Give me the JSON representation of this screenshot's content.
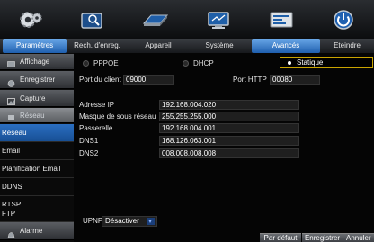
{
  "tabs": [
    {
      "label": "Paramètres"
    },
    {
      "label": "Rech. d'enreg."
    },
    {
      "label": "Appareil"
    },
    {
      "label": "Système"
    },
    {
      "label": "Avancés"
    },
    {
      "label": "Eteindre"
    }
  ],
  "icons": [
    "settings-gear-icon",
    "search-record-icon",
    "device-icon",
    "system-icon",
    "advanced-icon",
    "power-icon"
  ],
  "sidebar": {
    "items": [
      {
        "label": "Affichage",
        "icon": "display-icon"
      },
      {
        "label": "Enregistrer",
        "icon": "record-icon"
      },
      {
        "label": "Capture",
        "icon": "capture-icon"
      },
      {
        "label": "Réseau",
        "icon": "network-icon"
      }
    ],
    "sub": [
      {
        "label": "Réseau"
      },
      {
        "label": "Email"
      },
      {
        "label": "Planification Email"
      },
      {
        "label": "DDNS"
      },
      {
        "label": "RTSP"
      },
      {
        "label": "FTP"
      }
    ],
    "alarm": {
      "label": "Alarme",
      "icon": "alarm-icon"
    }
  },
  "network": {
    "modes": [
      "PPPOE",
      "DHCP",
      "Statique"
    ],
    "selected_mode": "Statique",
    "client_port_label": "Port du client",
    "client_port": "09000",
    "http_port_label": "Port HTTP",
    "http_port": "00080",
    "ip_label": "Adresse IP",
    "ip": "192.168.004.020",
    "mask_label": "Masque de sous réseau",
    "mask": "255.255.255.000",
    "gateway_label": "Passerelle",
    "gateway": "192.168.004.001",
    "dns1_label": "DNS1",
    "dns1": "168.126.063.001",
    "dns2_label": "DNS2",
    "dns2": "008.008.008.008",
    "upnp_label": "UPNP",
    "upnp_value": "Désactiver"
  },
  "buttons": {
    "default": "Par défaut",
    "save": "Enregistrer",
    "cancel": "Annuler"
  }
}
